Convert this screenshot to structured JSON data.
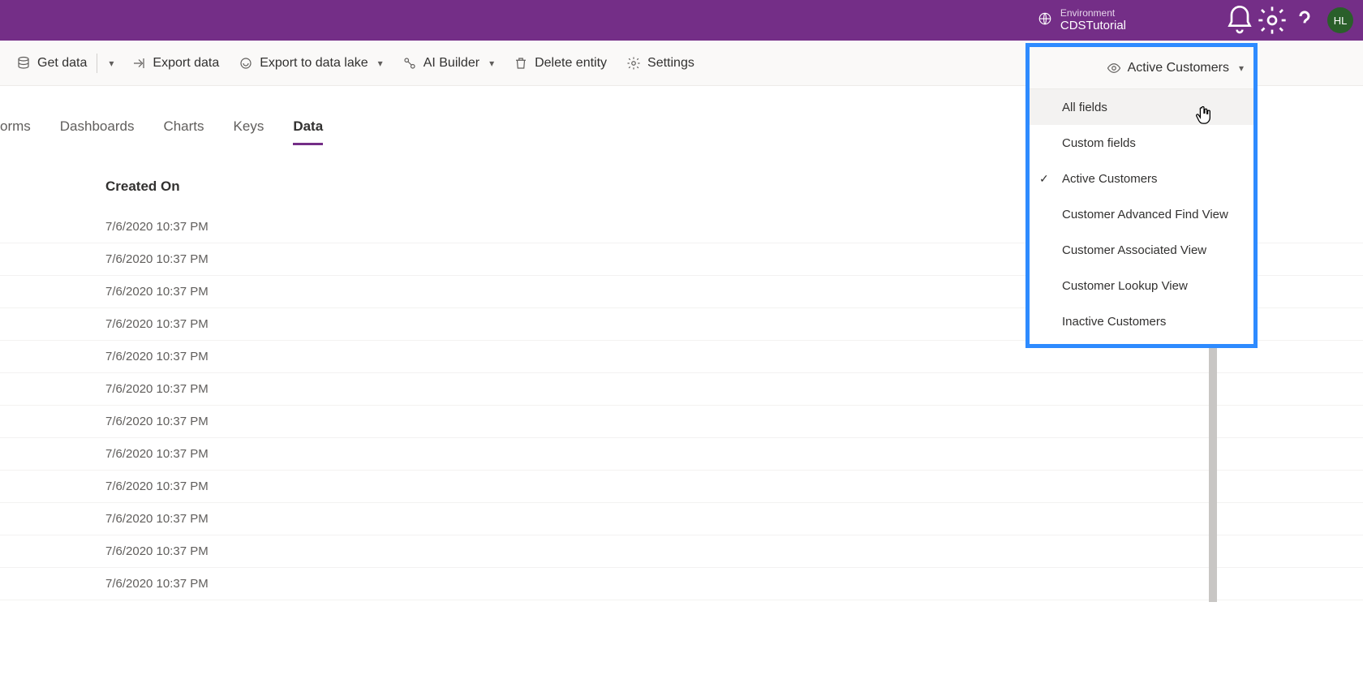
{
  "header": {
    "environment_label": "Environment",
    "environment_name": "CDSTutorial",
    "avatar_initials": "HL"
  },
  "command_bar": {
    "get_data": "Get data",
    "export_data": "Export data",
    "export_lake": "Export to data lake",
    "ai_builder": "AI Builder",
    "delete_entity": "Delete entity",
    "settings": "Settings",
    "view_selector": "Active Customers"
  },
  "tabs": {
    "t0": "orms",
    "t1": "Dashboards",
    "t2": "Charts",
    "t3": "Keys",
    "t4": "Data"
  },
  "table": {
    "col_created_on": "Created On",
    "rows": [
      "7/6/2020 10:37 PM",
      "7/6/2020 10:37 PM",
      "7/6/2020 10:37 PM",
      "7/6/2020 10:37 PM",
      "7/6/2020 10:37 PM",
      "7/6/2020 10:37 PM",
      "7/6/2020 10:37 PM",
      "7/6/2020 10:37 PM",
      "7/6/2020 10:37 PM",
      "7/6/2020 10:37 PM",
      "7/6/2020 10:37 PM",
      "7/6/2020 10:37 PM"
    ]
  },
  "dropdown": {
    "selector_label": "Active Customers",
    "items": {
      "all_fields": "All fields",
      "custom_fields": "Custom fields",
      "active_customers": "Active Customers",
      "adv_find": "Customer Advanced Find View",
      "assoc_view": "Customer Associated View",
      "lookup_view": "Customer Lookup View",
      "inactive": "Inactive Customers"
    }
  }
}
